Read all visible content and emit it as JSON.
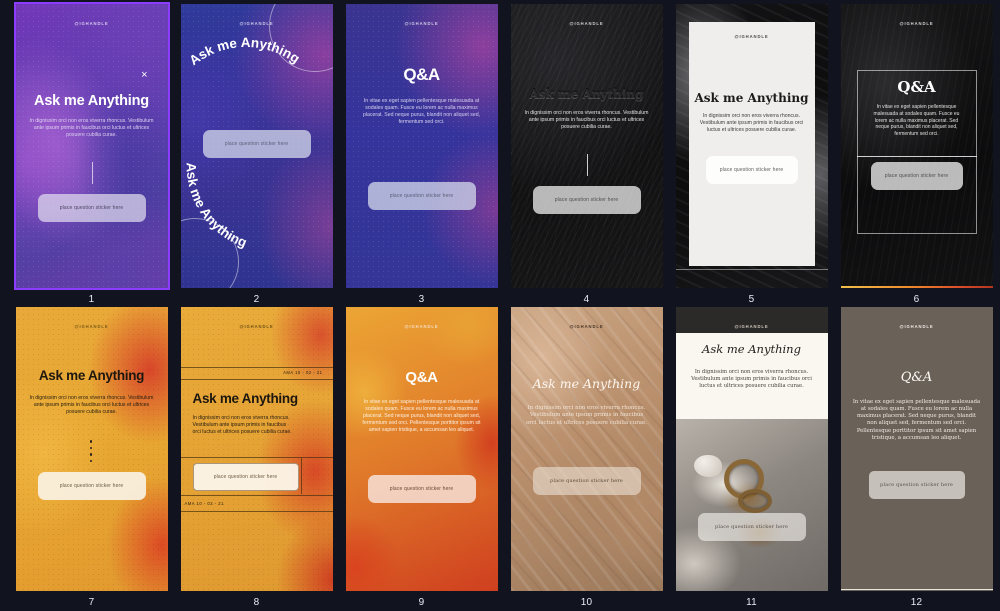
{
  "app": {
    "background_color": "#11141e",
    "selection_color": "#8b3dff",
    "layout": {
      "columns": 6,
      "rows": 2,
      "total_items": 12
    }
  },
  "common": {
    "handle": "@IGHANDLE",
    "sticker_label": "place question sticker here",
    "close_icon": "×",
    "body_ama": "In dignissim orci non eros viverra rhoncus. Vestibulum ante ipsum primis in faucibus orci luctus et ultrices posuere cubilia curae.",
    "body_qa_short": "In vitae ex eget sapien pellentesque malesuada at sodales quam. Fusce eu lorem ac nulla maximus placerat. Sed neque purus, blandit non aliquet sed, fermentum sed orci.",
    "body_qa_long": "In vitae ex eget sapien pellentesque malesuada at sodales quam. Fusce eu lorem ac nulla maximus placerat. Sed neque purus, blandit non aliquet sed, fermentum sed orci. Pellentesque porttitor ipsum sit amet sapien tristique, a accumsan leo aliquet."
  },
  "thumbnails": [
    {
      "number": "1",
      "selected": true,
      "title": "Ask me Anything",
      "handle": "@IGHANDLE",
      "body": "In dignissim orci non eros viverra rhoncus. Vestibulum ante ipsum primis in faucibus orci luctus et ultrices posuere cubilia curae.",
      "sticker": "place question sticker here",
      "close_icon": "×",
      "style": "purple-gradient",
      "colors": {
        "primary": "#7337b8",
        "secondary": "#4e3fa2"
      }
    },
    {
      "number": "2",
      "selected": false,
      "title_arc_top": "Ask me Anything",
      "title_arc_bottom": "Ask me Anything",
      "handle": "@IGHANDLE",
      "sticker": "place question sticker here",
      "style": "blue-arc",
      "colors": {
        "primary": "#37349c",
        "secondary": "#8a3f9e"
      }
    },
    {
      "number": "3",
      "selected": false,
      "title": "Q&A",
      "handle": "@IGHANDLE",
      "body": "In vitae ex eget sapien pellentesque malesuada at sodales quam. Fusce eu lorem ac nulla maximus placerat. Sed neque purus, blandit non aliquet sed, fermentum sed orci.",
      "sticker": "place question sticker here",
      "style": "blue-violet",
      "colors": {
        "primary": "#35349c",
        "secondary": "#8d3f9d"
      }
    },
    {
      "number": "4",
      "selected": false,
      "title": "Ask me Anything",
      "handle": "@IGHANDLE",
      "body": "In dignissim orci non eros viverra rhoncus. Vestibulum ante ipsum primis in faucibus orci luctus et ultrices posuere cubilia curae.",
      "sticker": "place question sticker here",
      "style": "dark-sand-emboss",
      "colors": {
        "primary": "#1a1a1c",
        "secondary": "#2a2a2c"
      }
    },
    {
      "number": "5",
      "selected": false,
      "title": "Ask me Anything",
      "handle": "@IGHANDLE",
      "body": "In dignissim orci non eros viverra rhoncus. Vestibulum ante ipsum primis in faucibus orci luctus et ultrices posuere cubilia curae.",
      "sticker": "place question sticker here",
      "style": "white-card-on-dark-photo",
      "colors": {
        "primary": "#f0eeec",
        "secondary": "#131315"
      }
    },
    {
      "number": "6",
      "selected": false,
      "title": "Q&A",
      "handle": "@IGHANDLE",
      "body": "In vitae ex eget sapien pellentesque malesuada at sodales quam. Fusce eu lorem ac nulla maximus placerat. Sed neque purus, blandit non aliquet sed, fermentum sed orci.",
      "sticker": "place question sticker here",
      "style": "dark-framed-serif",
      "colors": {
        "primary": "#0c0c0d",
        "accent_strip": "#ef8b2b"
      }
    },
    {
      "number": "7",
      "selected": false,
      "title": "Ask me Anything",
      "handle": "@IGHANDLE",
      "body": "In dignissim orci non eros viverra rhoncus. Vestibulum ante ipsum primis in faucibus orci luctus et ultrices posuere cubilia curae.",
      "sticker": "place question sticker here",
      "style": "yellow-orange-gradient",
      "colors": {
        "primary": "#e9a93a",
        "secondary": "#d8462a"
      }
    },
    {
      "number": "8",
      "selected": false,
      "title": "Ask me Anything",
      "handle": "@IGHANDLE",
      "body": "In dignissim orci non eros viverra rhoncus. Vestibulum ante ipsum primis in faucibus orci luctus et ultrices posuere cubilia curae.",
      "sticker": "place question sticker here",
      "date_top": "AMA 10 - 02 - 21",
      "date_bottom": "AMA 10 - 02 - 21",
      "style": "yellow-editorial-rules",
      "colors": {
        "primary": "#e5a234",
        "secondary": "#d84a26"
      }
    },
    {
      "number": "9",
      "selected": false,
      "title": "Q&A",
      "handle": "@IGHANDLE",
      "body": "In vitae ex eget sapien pellentesque malesuada at sodales quam. Fusce eu lorem ac nulla maximus placerat. Sed neque purus, blandit non aliquet sed, fermentum sed orci. Pellentesque porttitor ipsum sit amet sapien tristique, a accumsan leo aliquet.",
      "sticker": "place question sticker here",
      "style": "orange-red-blobs",
      "colors": {
        "primary": "#eca634",
        "secondary": "#cf3f1f"
      }
    },
    {
      "number": "10",
      "selected": false,
      "title": "Ask me Anything",
      "handle": "@IGHANDLE",
      "body": "In dignissim orci non eros viverra rhoncus. Vestibulum ante ipsum primis in faucibus orci luctus et ultrices posuere cubilia curae.",
      "sticker": "place question sticker here",
      "style": "beige-silk-script",
      "colors": {
        "primary": "#c9a482",
        "secondary": "#9c7a5c"
      }
    },
    {
      "number": "11",
      "selected": false,
      "title": "Ask me Anything",
      "handle": "@IGHANDLE",
      "body": "In dignissim orci non eros viverra rhoncus. Vestibulum ante ipsum primis in faucibus orci luctus et ultrices posuere cubilia curae.",
      "sticker": "place question sticker here",
      "style": "cream-card-jewelry-photo",
      "colors": {
        "primary": "#faf6f0",
        "secondary": "#8d8781"
      }
    },
    {
      "number": "12",
      "selected": false,
      "title": "Q&A",
      "handle": "@IGHANDLE",
      "body": "In vitae ex eget sapien pellentesque malesuada at sodales quam. Fusce eu lorem ac nulla maximus placerat. Sed neque purus, blandit non aliquet sed, fermentum sed orci. Pellentesque porttitor ipsum sit amet sapien tristique, a accumsan leo aliquet.",
      "sticker": "place question sticker here",
      "style": "taupe-solid-serif",
      "colors": {
        "primary": "#6a6159"
      }
    }
  ]
}
